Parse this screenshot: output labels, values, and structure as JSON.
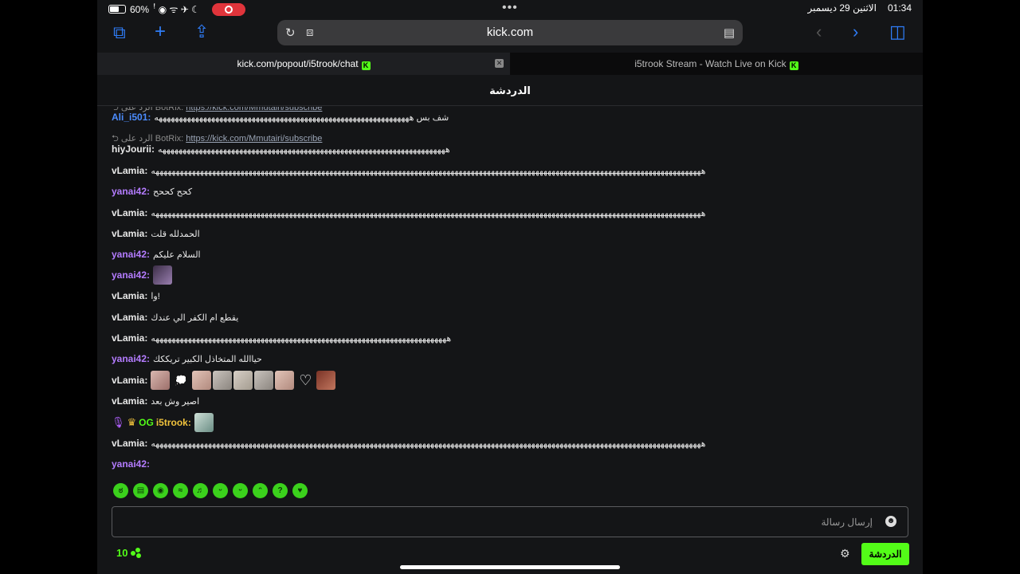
{
  "status": {
    "battery": "60%",
    "date": "الاثنين 29 ديسمبر",
    "time": "01:34"
  },
  "browser": {
    "url": "kick.com",
    "tabs": [
      {
        "label": "kick.com/popout/i5trook/chat"
      },
      {
        "label": "i5trook Stream - Watch Live on Kick"
      }
    ]
  },
  "chat": {
    "title": "الدردشة",
    "messages": [
      {
        "user": "Ali_i501",
        "text": "شف بس هههههههههههههههههههههههههههههههههههههههههههههههههههههههههههههههه"
      },
      {
        "reply_prefix": "الرد على BotRix:",
        "reply_link": "https://kick.com/Mmutairi/subscribe"
      },
      {
        "user": "hiyJourii",
        "text": "هههههههههههههههههههههههههههههههههههههههههههههههههههههههههههههههههههههههه"
      },
      {
        "user": "vLamia",
        "text": "ههههههههههههههههههههههههههههههههههههههههههههههههههههههههههههههههههههههههههههههههههههههههههههههههههههههههههههههههههههههههههههههههههههههههه"
      },
      {
        "user": "yanai42",
        "text": "كحح كححح"
      },
      {
        "user": "vLamia",
        "text": "ههههههههههههههههههههههههههههههههههههههههههههههههههههههههههههههههههههههههههههههههههههههههههههههههههههههههههههههههههههههههههههههههههههههههه"
      },
      {
        "user": "vLamia",
        "text": "الحمدلله قلت"
      },
      {
        "user": "yanai42",
        "text": "السلام عليكم"
      },
      {
        "user": "yanai42",
        "text": ""
      },
      {
        "user": "vLamia",
        "text": "وا!"
      },
      {
        "user": "vLamia",
        "text": "يقطع ام الكفر الي عندك"
      },
      {
        "user": "vLamia",
        "text": "هههههههههههههههههههههههههههههههههههههههههههههههههههههههههههههههههههههههههه"
      },
      {
        "user": "yanai42",
        "text": "حياالله المتخاذل الكبير تريككك"
      },
      {
        "user": "vLamia",
        "text": ""
      },
      {
        "user": "vLamia",
        "text": "اصير وش بعد"
      },
      {
        "user": "i5trook",
        "text": ""
      },
      {
        "user": "vLamia",
        "text": "ههههههههههههههههههههههههههههههههههههههههههههههههههههههههههههههههههههههههههههههههههههههههههههههههههههههههههههههههههههههههههههههههههههههههه"
      },
      {
        "user": "yanai42",
        "text": ""
      }
    ],
    "input_placeholder": "إرسال رسالة",
    "viewers": "10",
    "chat_button": "الدردشة"
  }
}
